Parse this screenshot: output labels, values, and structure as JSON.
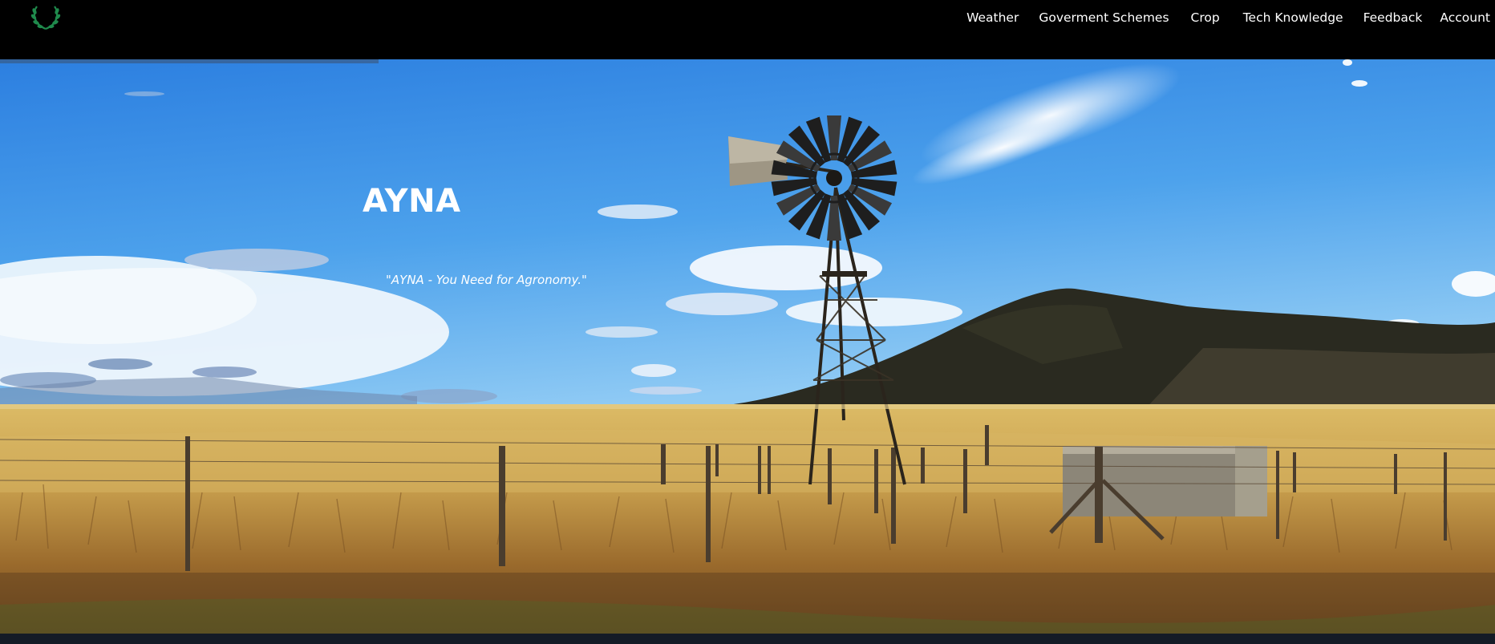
{
  "nav": {
    "logo_icon": "laurel-wreath-icon",
    "links": [
      {
        "label": "Weather"
      },
      {
        "label": "Goverment Schemes"
      },
      {
        "label": "Crop"
      },
      {
        "label": "Tech Knowledge"
      },
      {
        "label": "Feedback"
      },
      {
        "label": "Account"
      }
    ]
  },
  "hero": {
    "title": "AYNA",
    "tagline": "\"AYNA - You Need for Agronomy.\""
  },
  "colors": {
    "navbar": "#000000",
    "logo": "#1f8a4c",
    "sky_top": "#2c7fe0",
    "field": "#d6b25c",
    "footer": "#141b26"
  }
}
